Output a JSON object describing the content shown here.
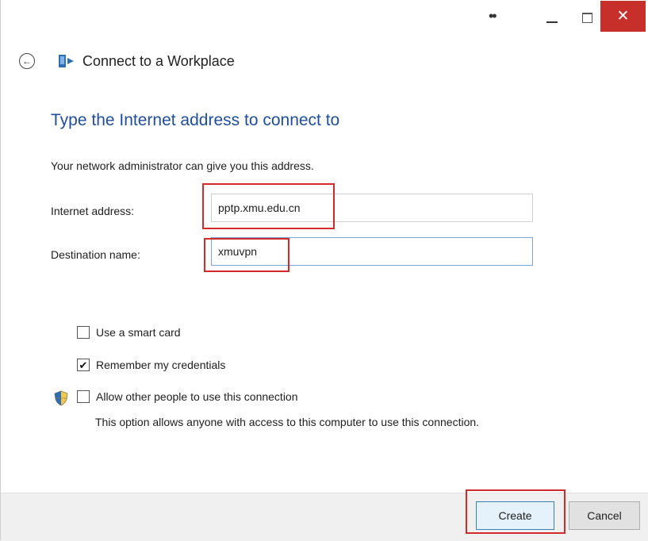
{
  "titlebar": {
    "menu_dots": "••",
    "close_glyph": "✕"
  },
  "nav": {
    "back_glyph": "←",
    "title": "Connect to a Workplace"
  },
  "content": {
    "heading": "Type the Internet address to connect to",
    "subtext": "Your network administrator can give you this address.",
    "internet_address_label": "Internet address:",
    "internet_address_value": "pptp.xmu.edu.cn",
    "destination_name_label": "Destination name:",
    "destination_name_value": "xmuvpn"
  },
  "options": {
    "smart_card_label": "Use a smart card",
    "smart_card_checked": false,
    "remember_label": "Remember my credentials",
    "remember_checked": true,
    "remember_mark": "✔",
    "allow_others_label": "Allow other people to use this connection",
    "allow_others_checked": false,
    "allow_others_note": "This option allows anyone with access to this computer to use this connection."
  },
  "footer": {
    "create_label": "Create",
    "cancel_label": "Cancel"
  },
  "colors": {
    "heading": "#1f4e9e",
    "close_button": "#c7302a",
    "highlight": "#d22a2a"
  }
}
